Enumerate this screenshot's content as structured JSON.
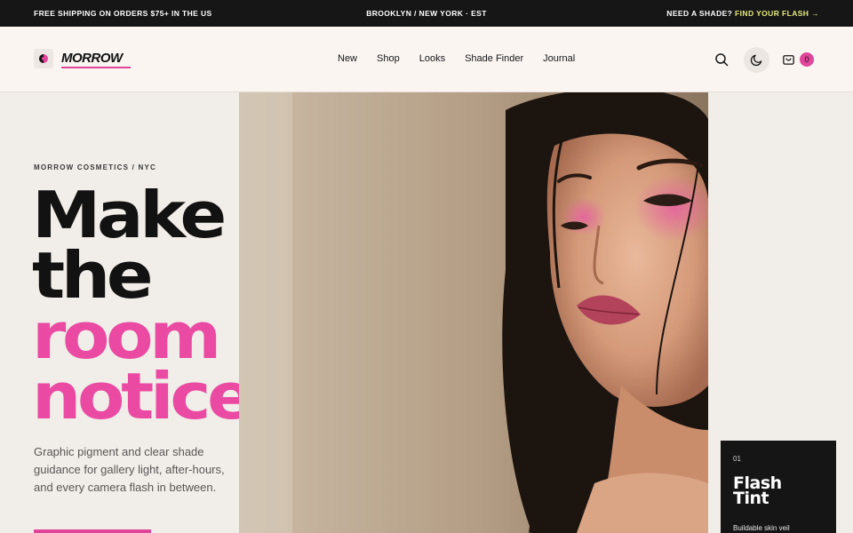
{
  "announcement": {
    "left": "FREE SHIPPING ON ORDERS $75+ IN THE US",
    "center": "BROOKLYN / NEW YORK · EST",
    "right_prefix": "NEED A SHADE? ",
    "right_cta": "FIND YOUR FLASH →"
  },
  "header": {
    "logo_text": "MORROW",
    "nav": [
      "New",
      "Shop",
      "Looks",
      "Shade Finder",
      "Journal"
    ],
    "cart_count": "0"
  },
  "hero": {
    "eyebrow": "MORROW COSMETICS / NYC",
    "headline_dark": [
      "Make",
      "the"
    ],
    "headline_pink": [
      "room",
      "notice."
    ],
    "lede": "Graphic pigment and clear shade guidance for gallery light, after-hours, and every camera flash in between."
  },
  "card": {
    "number": "01",
    "title_line1": "Flash",
    "title_line2": "Tint",
    "subtitle": "Buildable skin veil"
  },
  "colors": {
    "accent_pink": "#e0459a",
    "announcement_cta": "#e6ea7c",
    "dark": "#161616"
  },
  "icons": [
    "search-icon",
    "moon-icon",
    "bag-icon"
  ]
}
